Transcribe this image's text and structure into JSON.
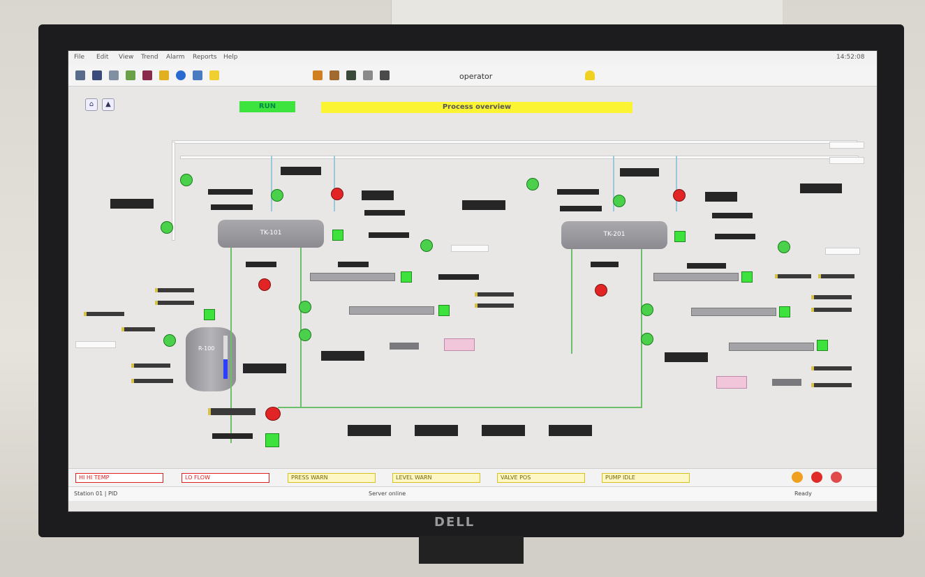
{
  "monitor": {
    "brand": "DELL"
  },
  "menubar": {
    "items": [
      "File",
      "Edit",
      "View",
      "Trend",
      "Alarm",
      "Reports",
      "Help"
    ],
    "clock": "14:52:08"
  },
  "toolbar": {
    "icons": [
      "back-icon",
      "save-icon",
      "print-icon",
      "trend-icon",
      "alarm-icon",
      "folder-icon",
      "globe-icon",
      "screen-icon",
      "light-icon"
    ],
    "user_label": "operator",
    "lock_label": "lock"
  },
  "status": {
    "mode_label": "RUN",
    "message": "Process overview"
  },
  "alarms": [
    {
      "text": "HI HI TEMP",
      "level": "red"
    },
    {
      "text": "LO FLOW",
      "level": "red"
    },
    {
      "text": "PRESS WARN",
      "level": "yellow"
    },
    {
      "text": "LEVEL WARN",
      "level": "yellow"
    },
    {
      "text": "VALVE POS",
      "level": "yellow"
    },
    {
      "text": "PUMP IDLE",
      "level": "yellow"
    }
  ],
  "statusbar": {
    "left": "Station 01 | PID",
    "center": "Server online",
    "right": "Ready"
  },
  "tanks": [
    {
      "label": "TK-101"
    },
    {
      "label": "TK-201"
    }
  ],
  "vessel": {
    "label": "R-100",
    "level_percent": 45
  },
  "colors": {
    "running": "#3de23d",
    "stopped": "#e32424",
    "warning": "#fbf433",
    "pipe": "#9bc7da"
  }
}
